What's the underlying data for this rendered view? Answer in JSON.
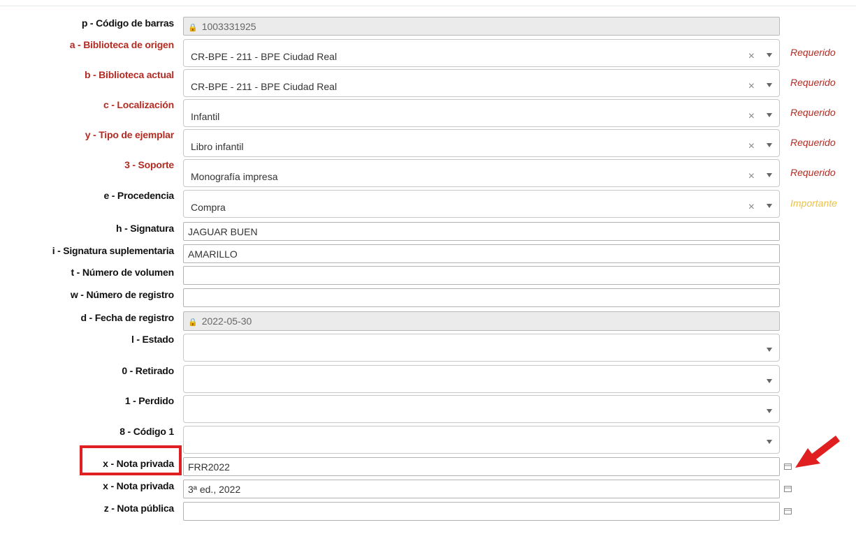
{
  "fields": [
    {
      "label": "p - Código de barras",
      "value": "1003331925",
      "type": "readonly"
    },
    {
      "label": "a - Biblioteca de origen",
      "value": "CR-BPE - 211 - BPE Ciudad Real",
      "type": "select",
      "hint": "Requerido"
    },
    {
      "label": "b - Biblioteca actual",
      "value": "CR-BPE - 211 - BPE Ciudad Real",
      "type": "select",
      "hint": "Requerido"
    },
    {
      "label": "c - Localización",
      "value": "Infantil",
      "type": "select",
      "hint": "Requerido"
    },
    {
      "label": "y - Tipo de ejemplar",
      "value": "Libro infantil",
      "type": "select",
      "hint": "Requerido"
    },
    {
      "label": "3 - Soporte",
      "value": "Monografía impresa",
      "type": "select",
      "hint": "Requerido"
    },
    {
      "label": "e - Procedencia",
      "value": "Compra",
      "type": "select",
      "hint": "Importante"
    },
    {
      "label": "h - Signatura",
      "value": "JAGUAR BUEN",
      "type": "text"
    },
    {
      "label": "i - Signatura suplementaria",
      "value": "AMARILLO",
      "type": "text"
    },
    {
      "label": "t - Número de volumen",
      "value": "",
      "type": "text"
    },
    {
      "label": "w - Número de registro",
      "value": "",
      "type": "text"
    },
    {
      "label": "d - Fecha de registro",
      "value": "2022-05-30",
      "type": "readonly"
    },
    {
      "label": "l - Estado",
      "value": "",
      "type": "select"
    },
    {
      "label": "0 - Retirado",
      "value": "",
      "type": "select"
    },
    {
      "label": "1 - Perdido",
      "value": "",
      "type": "select"
    },
    {
      "label": "8 - Código 1",
      "value": "",
      "type": "select"
    },
    {
      "label": "x - Nota privada",
      "value": "FRR2022",
      "type": "text",
      "note_icon": "note-icon"
    },
    {
      "label": "x - Nota privada",
      "value": "3ª ed., 2022",
      "type": "text",
      "note_icon": "note-icon"
    },
    {
      "label": "z - Nota pública",
      "value": "",
      "type": "text",
      "note_icon": "note-icon"
    }
  ],
  "icons": {
    "readonly": "lock-icon",
    "clear": "clear-icon",
    "dropdown": "chevron-down-icon",
    "note": "note-icon"
  },
  "glyphs": {
    "clear": "×",
    "lock": "🔒"
  },
  "colors": {
    "required": "#b32b22",
    "important": "#e8c24a",
    "annotation": "#e02020"
  }
}
